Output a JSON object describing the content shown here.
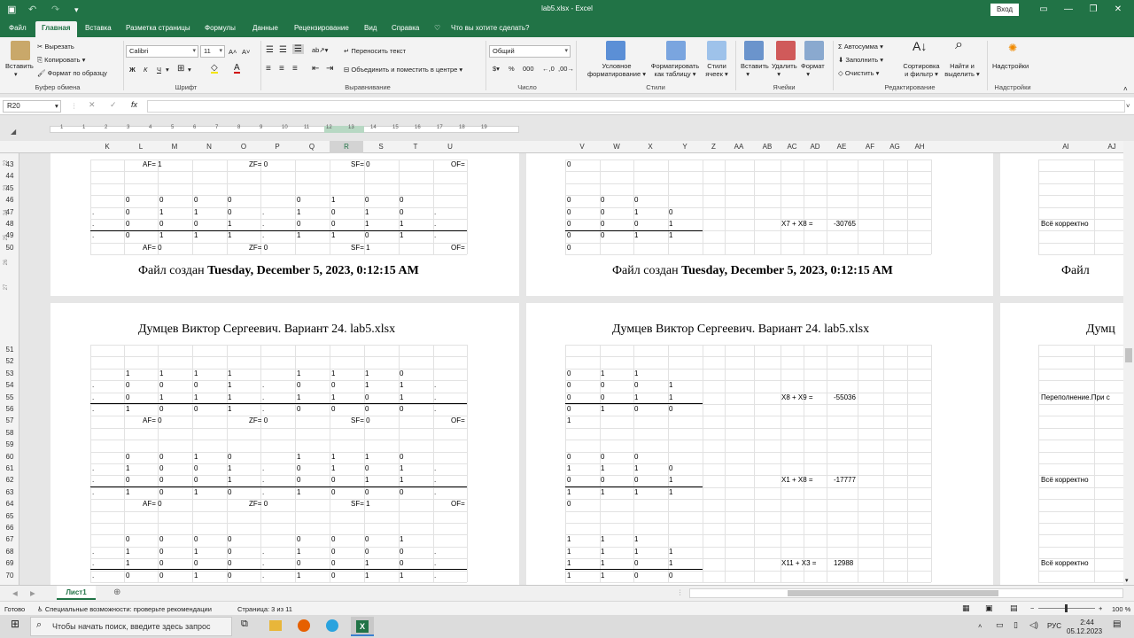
{
  "app": {
    "title": "lab5.xlsx  -  Excel",
    "signin": "Вход"
  },
  "colors": {
    "brand": "#217346"
  },
  "tabs": [
    "Файл",
    "Главная",
    "Вставка",
    "Разметка страницы",
    "Формулы",
    "Данные",
    "Рецензирование",
    "Вид",
    "Справка"
  ],
  "tell_me": "Что вы хотите сделать?",
  "ribbon": {
    "clipboard": {
      "paste": "Вставить",
      "cut": "Вырезать",
      "copy": "Копировать",
      "format_painter": "Формат по образцу",
      "label": "Буфер обмена"
    },
    "font": {
      "name": "Calibri",
      "size": "11",
      "bold": "Ж",
      "italic": "К",
      "underline": "Ч",
      "label": "Шрифт"
    },
    "alignment": {
      "wrap": "Переносить текст",
      "merge": "Объединить и поместить в центре",
      "label": "Выравнивание"
    },
    "number": {
      "format": "Общий",
      "label": "Число"
    },
    "styles": {
      "conditional": [
        "Условное",
        "форматирование"
      ],
      "as_table": [
        "Форматировать",
        "как таблицу"
      ],
      "cell_styles": [
        "Стили",
        "ячеек"
      ],
      "label": "Стили"
    },
    "cells": {
      "insert": "Вставить",
      "delete": "Удалить",
      "format": "Формат",
      "label": "Ячейки"
    },
    "editing": {
      "autosum": "Автосумма",
      "fill": "Заполнить",
      "clear": "Очистить",
      "sort": [
        "Сортировка",
        "и фильтр"
      ],
      "find": [
        "Найти и",
        "выделить"
      ],
      "label": "Редактирование"
    },
    "addins": {
      "btn": "Надстройки",
      "label": "Надстройки"
    }
  },
  "formula_bar": {
    "name_box": "R20",
    "fx": "fx",
    "value": ""
  },
  "ruler": [
    "1",
    "1",
    "2",
    "3",
    "4",
    "5",
    "6",
    "7",
    "8",
    "9",
    "10",
    "11",
    "12",
    "13",
    "14",
    "15",
    "16",
    "17",
    "18",
    "19"
  ],
  "columns": {
    "left": [
      "K",
      "L",
      "M",
      "N",
      "O",
      "P",
      "Q",
      "R",
      "S",
      "T",
      "U"
    ],
    "middle": [
      "V",
      "W",
      "X",
      "Y",
      "Z",
      "AA",
      "AB",
      "AC",
      "AD",
      "AE",
      "AF",
      "AG",
      "AH"
    ],
    "right": [
      "AI",
      "AJ"
    ],
    "selected": "R"
  },
  "rows_top": [
    "43",
    "44",
    "45",
    "46",
    "47",
    "48",
    "49",
    "50"
  ],
  "rows_bottom": [
    "51",
    "52",
    "53",
    "54",
    "55",
    "56",
    "57",
    "58",
    "59",
    "60",
    "61",
    "62",
    "63",
    "64",
    "65",
    "66",
    "67",
    "68",
    "69",
    "70"
  ],
  "side_rows": [
    "22",
    "23",
    "24",
    "25",
    "26",
    "27"
  ],
  "page_footer": {
    "prefix": "Файл создан ",
    "date": "Tuesday, December 5, 2023, 0:12:15 AM",
    "short": "Файл"
  },
  "page_header": {
    "text": "Думцев Виктор Сергеевич. Вариант 24. lab5.xlsx",
    "short": "Думц"
  },
  "flags": {
    "af": "AF=",
    "zf": "ZF=",
    "sf": "SF=",
    "of": "OF="
  },
  "top_block": {
    "rows": [
      {
        "flags": [
          "1",
          "0",
          "0"
        ]
      },
      {},
      {},
      {
        "dot": "",
        "bits": [
          "0",
          "0",
          "0",
          "0",
          "",
          "0",
          "1",
          "0",
          "0"
        ],
        "end": "",
        "m": [
          "0",
          "0",
          "0",
          ""
        ]
      },
      {
        "dot": ".",
        "bits": [
          "0",
          "1",
          "1",
          "0",
          ".",
          "1",
          "0",
          "1",
          "0"
        ],
        "end": ".",
        "m": [
          "0",
          "0",
          "1",
          "0"
        ]
      },
      {
        "dot": ".",
        "bits": [
          "0",
          "0",
          "0",
          "1",
          ".",
          "0",
          "0",
          "1",
          "1"
        ],
        "end": ".",
        "m": [
          "0",
          "0",
          "0",
          "1"
        ],
        "expr": "X7 + X8 =",
        "res": "-30765",
        "status": "Всё корректно"
      },
      {
        "dot": ".",
        "bits": [
          "0",
          "1",
          "1",
          "1",
          ".",
          "1",
          "1",
          "0",
          "1"
        ],
        "end": ".",
        "m": [
          "0",
          "0",
          "1",
          "1"
        ]
      },
      {
        "flags": [
          "0",
          "0",
          "1"
        ],
        "m": [
          "0",
          "",
          "",
          ""
        ]
      }
    ],
    "first_m": "0"
  },
  "bottom_block": {
    "rows": [
      {},
      {},
      {
        "dot": "",
        "bits": [
          "1",
          "1",
          "1",
          "1",
          "",
          "1",
          "1",
          "1",
          "0"
        ],
        "end": "",
        "m": [
          "0",
          "1",
          "1",
          ""
        ]
      },
      {
        "dot": ".",
        "bits": [
          "0",
          "0",
          "0",
          "1",
          ".",
          "0",
          "0",
          "1",
          "1"
        ],
        "end": ".",
        "m": [
          "0",
          "0",
          "0",
          "1"
        ]
      },
      {
        "dot": ".",
        "bits": [
          "0",
          "1",
          "1",
          "1",
          ".",
          "1",
          "1",
          "0",
          "1"
        ],
        "end": ".",
        "m": [
          "0",
          "0",
          "1",
          "1"
        ],
        "expr": "X8 + X9 =",
        "res": "-55036",
        "status": "Переполнение.При с"
      },
      {
        "dot": ".",
        "bits": [
          "1",
          "0",
          "0",
          "1",
          ".",
          "0",
          "0",
          "0",
          "0"
        ],
        "end": ".",
        "m": [
          "0",
          "1",
          "0",
          "0"
        ]
      },
      {
        "flags": [
          "0",
          "0",
          "0"
        ],
        "m": [
          "1",
          "",
          "",
          ""
        ]
      },
      {},
      {},
      {
        "dot": "",
        "bits": [
          "0",
          "0",
          "1",
          "0",
          "",
          "1",
          "1",
          "1",
          "0"
        ],
        "end": "",
        "m": [
          "0",
          "0",
          "0",
          ""
        ]
      },
      {
        "dot": ".",
        "bits": [
          "1",
          "0",
          "0",
          "1",
          ".",
          "0",
          "1",
          "0",
          "1"
        ],
        "end": ".",
        "m": [
          "1",
          "1",
          "1",
          "0"
        ]
      },
      {
        "dot": ".",
        "bits": [
          "0",
          "0",
          "0",
          "1",
          ".",
          "0",
          "0",
          "1",
          "1"
        ],
        "end": ".",
        "m": [
          "0",
          "0",
          "0",
          "1"
        ],
        "expr": "X1 + X8 =",
        "res": "-17777",
        "status": "Всё корректно"
      },
      {
        "dot": ".",
        "bits": [
          "1",
          "0",
          "1",
          "0",
          ".",
          "1",
          "0",
          "0",
          "0"
        ],
        "end": ".",
        "m": [
          "1",
          "1",
          "1",
          "1"
        ]
      },
      {
        "flags": [
          "0",
          "0",
          "1"
        ],
        "m": [
          "0",
          "",
          "",
          ""
        ]
      },
      {},
      {},
      {
        "dot": "",
        "bits": [
          "0",
          "0",
          "0",
          "0",
          "",
          "0",
          "0",
          "0",
          "1"
        ],
        "end": "",
        "m": [
          "1",
          "1",
          "1",
          ""
        ]
      },
      {
        "dot": ".",
        "bits": [
          "1",
          "0",
          "1",
          "0",
          ".",
          "1",
          "0",
          "0",
          "0"
        ],
        "end": ".",
        "m": [
          "1",
          "1",
          "1",
          "1"
        ]
      },
      {
        "dot": ".",
        "bits": [
          "1",
          "0",
          "0",
          "0",
          ".",
          "0",
          "0",
          "1",
          "0"
        ],
        "end": ".",
        "m": [
          "1",
          "1",
          "0",
          "1"
        ],
        "expr": "X11 + X3 =",
        "res": "12988",
        "status": "Всё корректно"
      },
      {
        "dot": ".",
        "bits": [
          "0",
          "0",
          "1",
          "0",
          ".",
          "1",
          "0",
          "1",
          "1"
        ],
        "end": ".",
        "m": [
          "1",
          "1",
          "0",
          "0"
        ]
      }
    ]
  },
  "sheet_tab": "Лист1",
  "status": {
    "ready": "Готово",
    "accessibility": "Специальные возможности: проверьте рекомендации",
    "page": "Страница: 3 из 11",
    "zoom": "100 %"
  },
  "taskbar": {
    "search": "Чтобы начать поиск, введите здесь запрос",
    "lang": "РУС",
    "time": "2:44",
    "date": "05.12.2023"
  }
}
